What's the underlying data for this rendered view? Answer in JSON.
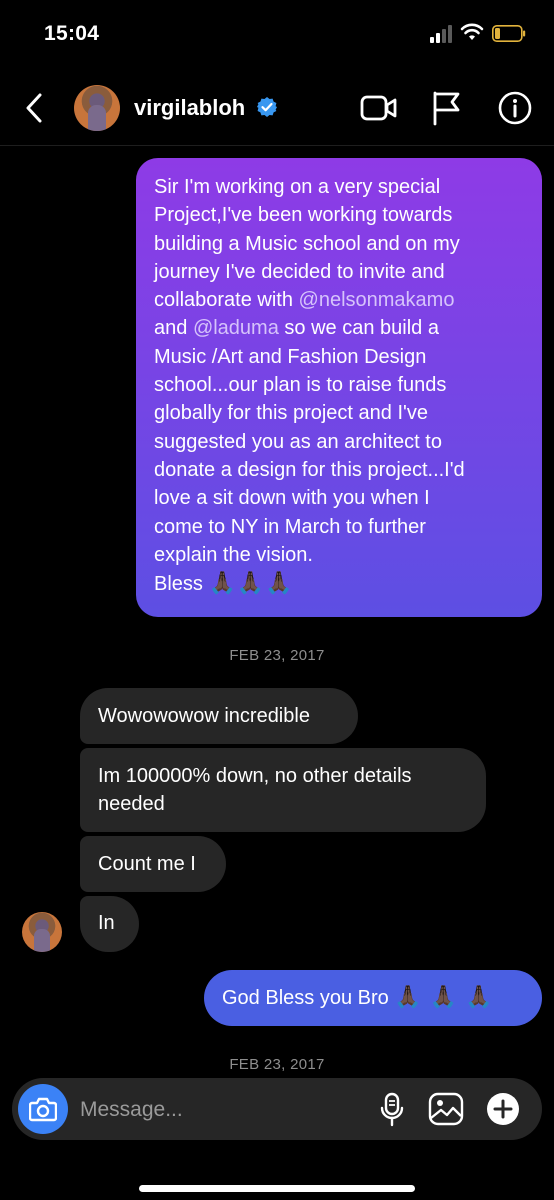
{
  "status_bar": {
    "time": "15:04"
  },
  "header": {
    "username": "virgilabloh",
    "verified": true,
    "icons": [
      "back-icon",
      "video-call-icon",
      "flag-icon",
      "info-icon"
    ]
  },
  "messages": {
    "sent_long": {
      "lines": [
        "Sir I'm working on a very special",
        "Project,I've been working towards",
        "building a Music school and on my",
        "journey I've decided to invite and",
        "collaborate with  ",
        "and ",
        " so we can build a",
        "Music /Art and Fashion Design",
        "school...our plan is to raise funds",
        "globally for this project and I've",
        "suggested you as an architect to",
        "donate a design for this project...I'd",
        "love a sit down with you when I",
        "come to NY in March to further",
        "explain the vision.",
        "Bless "
      ],
      "mention_1": "@nelsonmakamo",
      "mention_2": "@laduma",
      "emoji": "🙏🏿🙏🏿🙏🏿"
    },
    "date_1": "FEB 23, 2017",
    "received": [
      "Wowowowow incredible",
      "Im 100000% down, no other details",
      "needed",
      "Count me I",
      "In"
    ],
    "sent_short": {
      "text": "God Bless you Bro ",
      "emoji": "🙏🏿 🙏🏿 🙏🏿"
    },
    "date_2": "FEB 23, 2017"
  },
  "composer": {
    "placeholder": "Message...",
    "icons": [
      "camera-icon",
      "microphone-icon",
      "gallery-icon",
      "plus-icon"
    ]
  },
  "colors": {
    "sent_gradient_top": "#8e3be6",
    "sent_gradient_bottom": "#5d4fe3",
    "sent_short": "#4a5fe2",
    "received": "#262626",
    "camera_button": "#3b82f6",
    "verified": "#3897f0"
  }
}
